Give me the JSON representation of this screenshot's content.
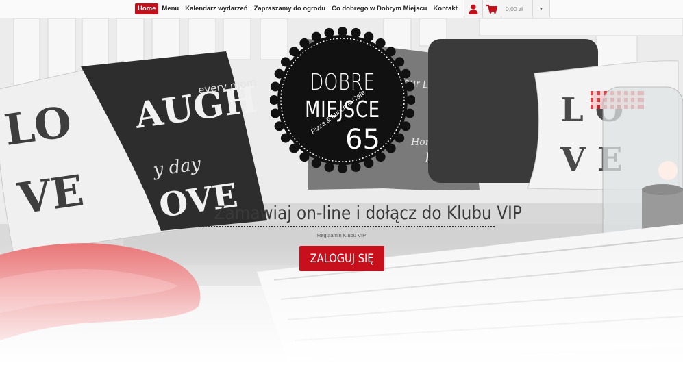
{
  "nav": {
    "items": [
      {
        "label": "Home",
        "active": true
      },
      {
        "label": "Menu"
      },
      {
        "label": "Kalendarz wydarzeń"
      },
      {
        "label": "Zapraszamy do ogrodu"
      },
      {
        "label": "Co dobrego w Dobrym Miejscu"
      },
      {
        "label": "Kontakt"
      }
    ]
  },
  "toolbar": {
    "user_icon": "user-icon",
    "cart_icon": "cart-icon",
    "cart_total": "0,00 zł",
    "dropdown_icon": "caret-down-icon"
  },
  "logo": {
    "line1": "DOBRE",
    "line2": "MIEJSCE",
    "tagline": "Pizza & Lunch & Cafe",
    "number": "65"
  },
  "hero": {
    "headline": "Zamawiaj on-line i dołącz do Klubu VIP",
    "vip_link": "Regulamin Klubu VIP",
    "login_label": "ZALOGUJ SIĘ"
  },
  "colors": {
    "accent": "#c5101c",
    "badge": "#111111",
    "text": "#3a3a3a"
  }
}
